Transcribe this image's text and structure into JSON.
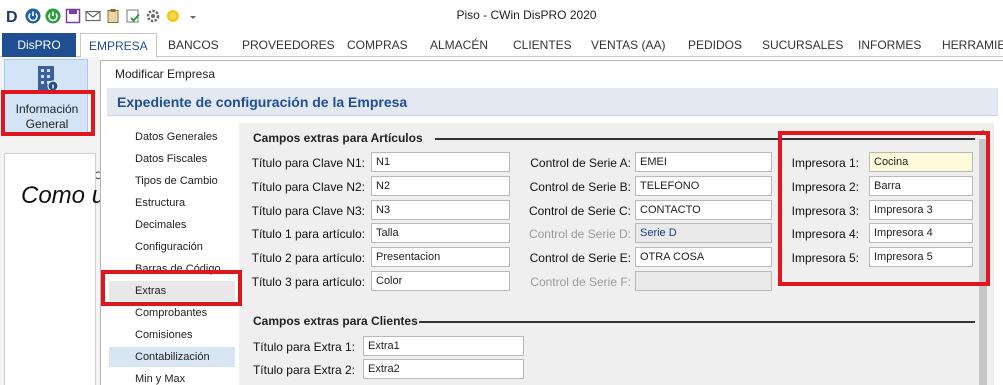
{
  "app": {
    "title": "Piso - CWin DisPRO 2020"
  },
  "quick_access": [
    "logo-icon",
    "power-blue-icon",
    "power-green-icon",
    "save-icon",
    "mail-icon",
    "clipboard-icon",
    "checklist-icon",
    "settings-icon",
    "sun-icon",
    "dropdown-icon"
  ],
  "ribbon": {
    "file_tab": "DisPRO",
    "tabs": [
      "EMPRESA",
      "BANCOS",
      "PROVEEDORES",
      "COMPRAS",
      "ALMACÉN",
      "CLIENTES",
      "VENTAS (AA)",
      "PEDIDOS",
      "SUCURSALES",
      "INFORMES",
      "HERRAMIEN"
    ],
    "active_tab": "EMPRESA"
  },
  "left": {
    "info_button": "Información General",
    "hint": "C",
    "background_text": "Como u"
  },
  "dialog": {
    "title": "Modificar Empresa",
    "header": "Expediente de configuración de la Empresa",
    "nav": [
      "Datos Generales",
      "Datos Fiscales",
      "Tipos de Cambio",
      "Estructura",
      "Decimales",
      "Configuración",
      "Barras de Código",
      "Extras",
      "Comprobantes",
      "Comisiones",
      "Contabilización",
      "Min y Max"
    ],
    "selected_nav": "Extras",
    "articulos": {
      "section_title": "Campos extras para Artículos",
      "claves": [
        {
          "label": "Título para Clave N1:",
          "value": "N1"
        },
        {
          "label": "Título para Clave N2:",
          "value": "N2"
        },
        {
          "label": "Título para Clave N3:",
          "value": "N3"
        },
        {
          "label": "Título 1 para artículo:",
          "value": "Talla"
        },
        {
          "label": "Título 2 para artículo:",
          "value": "Presentacion"
        },
        {
          "label": "Título 3 para artículo:",
          "value": "Color"
        }
      ],
      "series": [
        {
          "label": "Control de Serie A:",
          "value": "EMEI",
          "disabled": false
        },
        {
          "label": "Control de Serie B:",
          "value": "TELEFONO",
          "disabled": false
        },
        {
          "label": "Control de Serie C:",
          "value": "CONTACTO",
          "disabled": false
        },
        {
          "label": "Control de Serie D:",
          "value": "Serie D",
          "disabled": true
        },
        {
          "label": "Control de Serie E:",
          "value": "OTRA COSA",
          "disabled": false
        },
        {
          "label": "Control de Serie F:",
          "value": "",
          "disabled": true
        }
      ],
      "impresoras": [
        {
          "label": "Impresora 1:",
          "value": "Cocina"
        },
        {
          "label": "Impresora 2:",
          "value": "Barra"
        },
        {
          "label": "Impresora 3:",
          "value": "Impresora 3"
        },
        {
          "label": "Impresora 4:",
          "value": "Impresora 4"
        },
        {
          "label": "Impresora 5:",
          "value": "Impresora 5"
        }
      ]
    },
    "clientes": {
      "section_title": "Campos extras para Clientes",
      "extras": [
        {
          "label": "Título para Extra 1:",
          "value": "Extra1"
        },
        {
          "label": "Título para Extra 2:",
          "value": "Extra2"
        }
      ]
    }
  },
  "colors": {
    "accent": "#1f4e93",
    "highlight_red": "#e0161e"
  }
}
